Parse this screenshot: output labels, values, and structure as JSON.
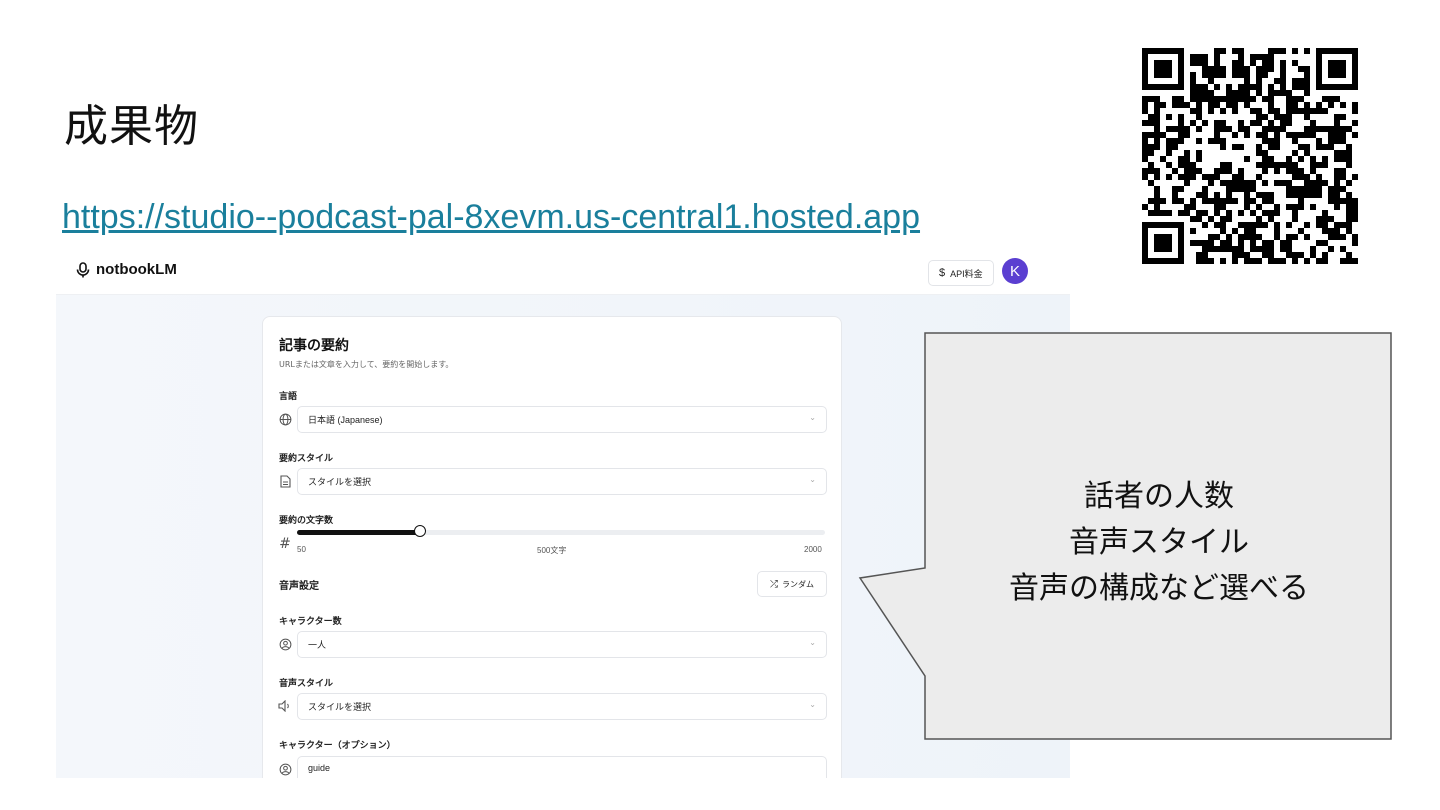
{
  "slide": {
    "title": "成果物",
    "link": "https://studio--podcast-pal-8xevm.us-central1.hosted.app"
  },
  "app": {
    "brand": "notbookLM",
    "price_button": "API料金",
    "price_icon": "$",
    "avatar_initial": "K",
    "accent_color": "#5b3fd1",
    "card": {
      "title": "記事の要約",
      "subtitle": "URLまたは文章を入力して、要約を開始します。",
      "language_label": "言語",
      "language_value": "日本語 (Japanese)",
      "style_label": "要約スタイル",
      "style_value": "スタイルを選択",
      "length_label": "要約の文字数",
      "length_min": "50",
      "length_current": "500文字",
      "length_max": "2000",
      "length_fraction": 0.2326,
      "voice_section": "音声設定",
      "random_button": "ランダム",
      "char_count_label": "キャラクター数",
      "char_count_value": "一人",
      "voice_style_label": "音声スタイル",
      "voice_style_value": "スタイルを選択",
      "character_label": "キャラクター（オプション）",
      "character_value": "guide"
    }
  },
  "callout": {
    "lines": [
      "話者の人数",
      "音声スタイル",
      "音声の構成など選べる"
    ]
  }
}
